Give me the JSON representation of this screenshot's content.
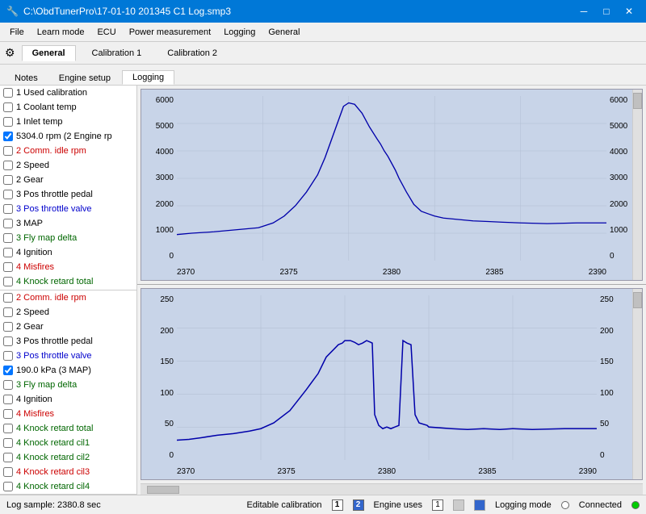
{
  "titleBar": {
    "title": "C:\\ObdTunerPro\\17-01-10 201345 C1 Log.smp3",
    "minimize": "─",
    "maximize": "□",
    "close": "✕"
  },
  "menuBar": {
    "items": [
      "File",
      "Learn mode",
      "ECU",
      "Power measurement",
      "Logging",
      "General"
    ]
  },
  "toolbar": {
    "tabs": [
      {
        "label": "⚙ General",
        "active": true
      },
      {
        "label": "Calibration 1",
        "active": false
      },
      {
        "label": "Calibration 2",
        "active": false
      }
    ]
  },
  "subTabs": {
    "items": [
      "Notes",
      "Engine setup",
      "Logging"
    ]
  },
  "leftPanel": {
    "topList": [
      {
        "id": 1,
        "checked": false,
        "label": "1 Used calibration",
        "colorClass": "color-1"
      },
      {
        "id": 2,
        "checked": false,
        "label": "1 Coolant temp",
        "colorClass": "color-1"
      },
      {
        "id": 3,
        "checked": false,
        "label": "1 Inlet temp",
        "colorClass": "color-1"
      },
      {
        "id": 4,
        "checked": true,
        "label": "5304.0 rpm (2 Engine rp",
        "colorClass": "color-1"
      },
      {
        "id": 5,
        "checked": false,
        "label": "2 Comm. idle rpm",
        "colorClass": "color-2"
      },
      {
        "id": 6,
        "checked": false,
        "label": "2 Speed",
        "colorClass": "color-1"
      },
      {
        "id": 7,
        "checked": false,
        "label": "2 Gear",
        "colorClass": "color-1"
      },
      {
        "id": 8,
        "checked": false,
        "label": "3 Pos throttle pedal",
        "colorClass": "color-1"
      },
      {
        "id": 9,
        "checked": false,
        "label": "3 Pos throttle valve",
        "colorClass": "color-3"
      },
      {
        "id": 10,
        "checked": false,
        "label": "3 MAP",
        "colorClass": "color-1"
      },
      {
        "id": 11,
        "checked": false,
        "label": "3 Fly map delta",
        "colorClass": "color-green"
      },
      {
        "id": 12,
        "checked": false,
        "label": "4 Ignition",
        "colorClass": "color-1"
      },
      {
        "id": 13,
        "checked": false,
        "label": "4 Misfires",
        "colorClass": "color-2"
      },
      {
        "id": 14,
        "checked": false,
        "label": "4 Knock retard total",
        "colorClass": "color-green"
      }
    ],
    "bottomList": [
      {
        "id": 1,
        "checked": false,
        "label": "2 Comm. idle rpm",
        "colorClass": "color-2"
      },
      {
        "id": 2,
        "checked": false,
        "label": "2 Speed",
        "colorClass": "color-1"
      },
      {
        "id": 3,
        "checked": false,
        "label": "2 Gear",
        "colorClass": "color-1"
      },
      {
        "id": 4,
        "checked": false,
        "label": "3 Pos throttle pedal",
        "colorClass": "color-1"
      },
      {
        "id": 5,
        "checked": false,
        "label": "3 Pos throttle valve",
        "colorClass": "color-3"
      },
      {
        "id": 6,
        "checked": true,
        "label": "190.0 kPa (3 MAP)",
        "colorClass": "color-1"
      },
      {
        "id": 7,
        "checked": false,
        "label": "3 Fly map delta",
        "colorClass": "color-green"
      },
      {
        "id": 8,
        "checked": false,
        "label": "4 Ignition",
        "colorClass": "color-1"
      },
      {
        "id": 9,
        "checked": false,
        "label": "4 Misfires",
        "colorClass": "color-2"
      },
      {
        "id": 10,
        "checked": false,
        "label": "4 Knock retard total",
        "colorClass": "color-green"
      },
      {
        "id": 11,
        "checked": false,
        "label": "4 Knock retard cil1",
        "colorClass": "color-green"
      },
      {
        "id": 12,
        "checked": false,
        "label": "4 Knock retard cil2",
        "colorClass": "color-green"
      },
      {
        "id": 13,
        "checked": false,
        "label": "4 Knock retard cil3",
        "colorClass": "color-2"
      },
      {
        "id": 14,
        "checked": false,
        "label": "4 Knock retard cil4",
        "colorClass": "color-green"
      }
    ]
  },
  "chart1": {
    "yAxisLeft": [
      "6000",
      "5000",
      "4000",
      "3000",
      "2000",
      "1000",
      "0"
    ],
    "yAxisRight": [
      "6000",
      "5000",
      "4000",
      "3000",
      "2000",
      "1000",
      "0"
    ],
    "xAxis": [
      "2370",
      "2375",
      "2380",
      "2385",
      "2390"
    ]
  },
  "chart2": {
    "yAxisLeft": [
      "250",
      "200",
      "150",
      "100",
      "50",
      "0"
    ],
    "yAxisRight": [
      "250",
      "200",
      "150",
      "100",
      "50",
      "0"
    ],
    "xAxis": [
      "2370",
      "2375",
      "2380",
      "2385",
      "2390"
    ]
  },
  "statusBar": {
    "logSample": "Log sample: 2380.8 sec",
    "editableCalibration": "Editable calibration",
    "engineUses": "Engine uses",
    "loggingMode": "Logging mode",
    "connected": "Connected"
  }
}
